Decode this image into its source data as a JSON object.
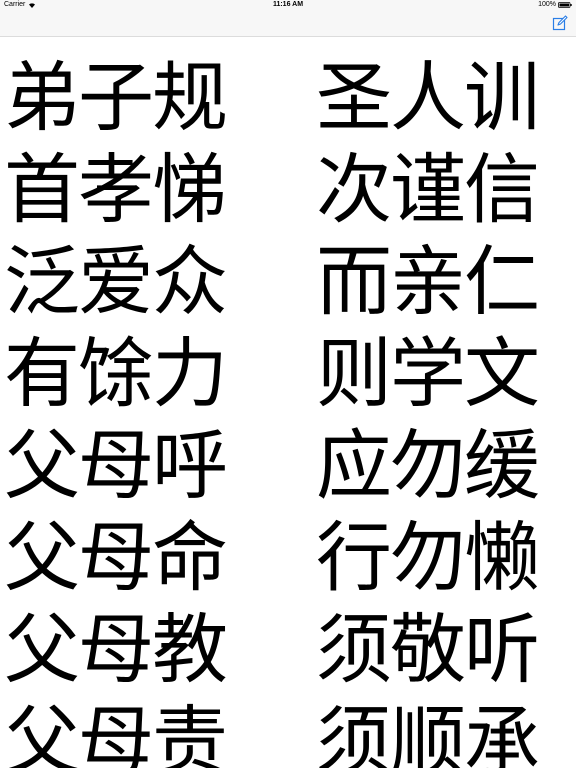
{
  "status_bar": {
    "carrier": "Carrier",
    "time": "11:16 AM",
    "battery": "100%"
  },
  "nav_bar": {
    "right_icon": "compose-icon"
  },
  "verses": [
    {
      "left": "弟子规",
      "right": "圣人训"
    },
    {
      "left": "首孝悌",
      "right": "次谨信"
    },
    {
      "left": "泛爱众",
      "right": "而亲仁"
    },
    {
      "left": "有馀力",
      "right": "则学文"
    },
    {
      "left": "父母呼",
      "right": "应勿缓"
    },
    {
      "left": "父母命",
      "right": "行勿懒"
    },
    {
      "left": "父母教",
      "right": "须敬听"
    },
    {
      "left": "父母责",
      "right": "须顺承"
    }
  ]
}
